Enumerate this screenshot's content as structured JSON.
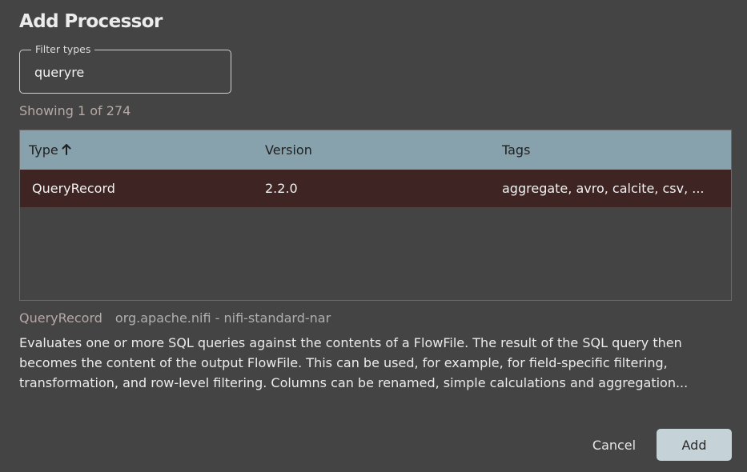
{
  "dialog": {
    "title": "Add Processor"
  },
  "filter": {
    "label": "Filter types",
    "value": "queryre"
  },
  "results": {
    "showing_text": "Showing 1 of 274"
  },
  "table": {
    "columns": [
      {
        "label": "Type",
        "sorted": "ascending"
      },
      {
        "label": "Version"
      },
      {
        "label": "Tags"
      }
    ],
    "rows": [
      {
        "type": "QueryRecord",
        "version": "2.2.0",
        "tags": "aggregate, avro, calcite, csv, ...",
        "selected": true
      }
    ]
  },
  "details": {
    "name": "QueryRecord",
    "bundle": "org.apache.nifi - nifi-standard-nar",
    "description": "Evaluates one or more SQL queries against the contents of a FlowFile. The result of the SQL query then becomes the content of the output FlowFile. This can be used, for example, for field-specific filtering, transformation, and row-level filtering. Columns can be renamed, simple calculations and aggregation..."
  },
  "actions": {
    "cancel_label": "Cancel",
    "add_label": "Add"
  },
  "colors": {
    "background": "#444444",
    "header": "#87a2ad",
    "selected_row": "#3e2523",
    "primary_button": "#c5d2d8"
  },
  "icons": {
    "sort": "arrow-up-icon"
  }
}
